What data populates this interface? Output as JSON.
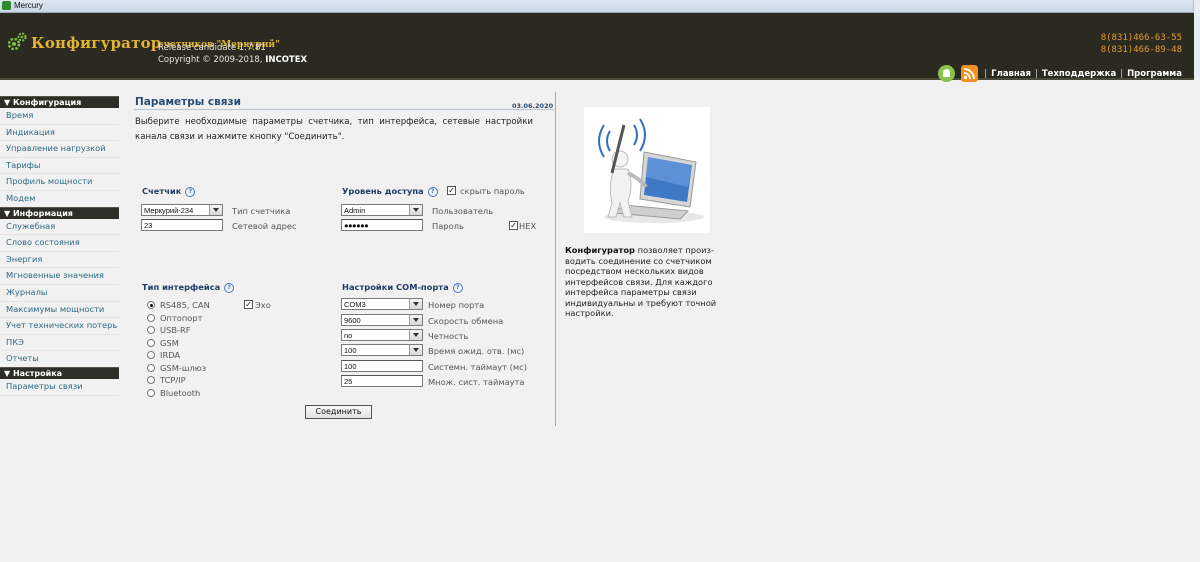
{
  "window": {
    "title": "Mercury"
  },
  "header": {
    "app_name": "Конфигуратор",
    "subtitle": "счетчиков \"Меркурий\"",
    "release": "Release candidate 1.7.81",
    "copyright_prefix": "Copyright © 2009-2018,",
    "copyright_company": "INCOTEX",
    "phones": [
      "8(831)466-63-55",
      "8(831)466-89-48"
    ],
    "nav": [
      "Главная",
      "Техподдержка",
      "Программа"
    ],
    "nav_icons": [
      "android-icon",
      "rss-icon"
    ]
  },
  "sidebar": {
    "sections": [
      {
        "title": "▼ Конфигурация",
        "items": [
          "Время",
          "Индикация",
          "Управление нагрузкой",
          "Тарифы",
          "Профиль мощности",
          "Модем"
        ]
      },
      {
        "title": "▼ Информация",
        "items": [
          "Служебная",
          "Слово состояния",
          "Энергия",
          "Мгновенные значения",
          "Журналы",
          "Максимумы мощности",
          "Учет технических потерь",
          "ПКЭ",
          "Отчеты"
        ]
      },
      {
        "title": "▼ Настройка",
        "items": [
          "Параметры связи"
        ]
      }
    ]
  },
  "main": {
    "title": "Параметры связи",
    "date": "03.06.2020",
    "description": "Выберите необходимые параметры счетчика, тип интерфейса, сетевые настройки канала связи и нажмите кнопку \"Соединить\".",
    "meter": {
      "label": "Счетчик",
      "type_value": "Меркурий-234",
      "type_label": "Тип счетчика",
      "address_value": "23",
      "address_label": "Сетевой адрес"
    },
    "access": {
      "label": "Уровень доступа",
      "hide_password_label": "скрыть пароль",
      "hide_password_checked": true,
      "user_value": "Admin",
      "user_label": "Пользователь",
      "password_value": "●●●●●●",
      "password_label": "Пароль",
      "hex_label": "HEX",
      "hex_checked": true
    },
    "interface": {
      "label": "Тип интерфейса",
      "options": [
        "RS485, CAN",
        "Оптопорт",
        "USB-RF",
        "GSM",
        "IRDA",
        "GSM-шлюз",
        "TCP/IP",
        "Bluetooth"
      ],
      "selected": "RS485, CAN",
      "echo_label": "Эхо",
      "echo_checked": true
    },
    "com": {
      "label": "Настройки COM-порта",
      "port_value": "COM3",
      "port_label": "Номер порта",
      "speed_value": "9600",
      "speed_label": "Скорость обмена",
      "parity_value": "no",
      "parity_label": "Четность",
      "wait_value": "100",
      "wait_label": "Время ожид. отв. (мс)",
      "sys_timeout_value": "100",
      "sys_timeout_label": "Системн. таймаут (мс)",
      "mult_value": "25",
      "mult_label": "Множ. сист. таймаута"
    },
    "connect_label": "Соединить"
  },
  "right_panel": {
    "bold": "Конфигуратор",
    "text": " позволяет произ-водить соединение со счетчиком посредством нескольких видов интерфейсов связи. Для каждого интерфейса параметры связи индивидуальны и требуют точной настройки."
  }
}
